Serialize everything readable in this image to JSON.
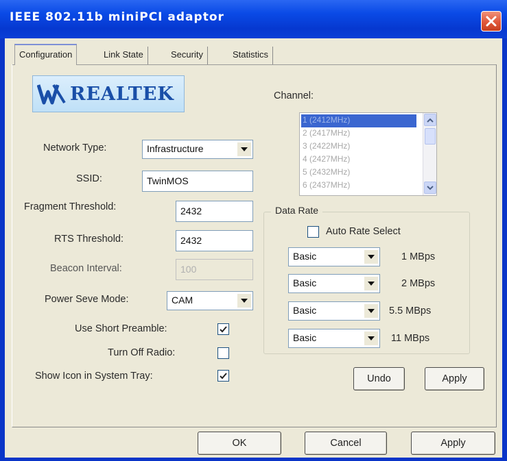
{
  "window": {
    "title": "IEEE 802.11b miniPCI adaptor"
  },
  "tabs": [
    {
      "label": "Configuration",
      "active": true
    },
    {
      "label": "Link State",
      "active": false
    },
    {
      "label": "Security",
      "active": false
    },
    {
      "label": "Statistics",
      "active": false
    }
  ],
  "logo": {
    "text": "REALTEK"
  },
  "config": {
    "network_type": {
      "label": "Network Type:",
      "value": "Infrastructure"
    },
    "ssid": {
      "label": "SSID:",
      "value": "TwinMOS"
    },
    "fragment_threshold": {
      "label": "Fragment Threshold:",
      "value": "2432"
    },
    "rts_threshold": {
      "label": "RTS Threshold:",
      "value": "2432"
    },
    "beacon_interval": {
      "label": "Beacon Interval:",
      "value": "100"
    },
    "power_save_mode": {
      "label": "Power Seve Mode:",
      "value": "CAM"
    },
    "use_short_preamble": {
      "label": "Use Short Preamble:",
      "checked": true
    },
    "turn_off_radio": {
      "label": "Turn Off Radio:",
      "checked": false
    },
    "show_icon_tray": {
      "label": "Show Icon in System Tray:",
      "checked": true
    }
  },
  "channel": {
    "label": "Channel:",
    "items": [
      "1 (2412MHz)",
      "2 (2417MHz)",
      "3 (2422MHz)",
      "4 (2427MHz)",
      "5 (2432MHz)",
      "6 (2437MHz)"
    ],
    "selected_index": 0
  },
  "data_rate": {
    "title": "Data Rate",
    "auto_rate_label": "Auto Rate Select",
    "auto_rate_checked": false,
    "rows": [
      {
        "value": "Basic",
        "rate": "1 MBps"
      },
      {
        "value": "Basic",
        "rate": "2 MBps"
      },
      {
        "value": "Basic",
        "rate": "5.5 MBps"
      },
      {
        "value": "Basic",
        "rate": "11 MBps"
      }
    ]
  },
  "buttons": {
    "undo": "Undo",
    "apply_inner": "Apply",
    "ok": "OK",
    "cancel": "Cancel",
    "apply": "Apply"
  },
  "colors": {
    "titlebar": "#0a4ae6",
    "dialog_bg": "#ece9d8",
    "close_button": "#e0573a",
    "list_selection": "#3a66d0"
  }
}
